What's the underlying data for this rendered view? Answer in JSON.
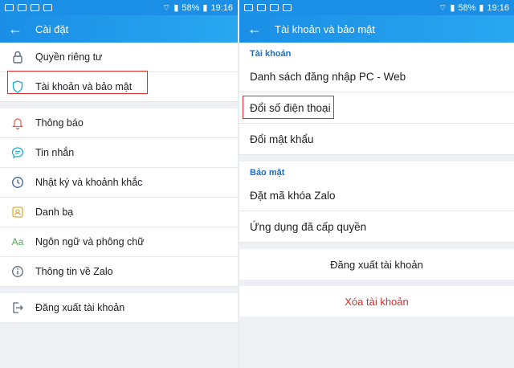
{
  "status": {
    "battery": "58%",
    "time": "19:16"
  },
  "left": {
    "title": "Cài đặt",
    "items_top": [
      {
        "icon": "lock-icon",
        "label": "Quyền riêng tư"
      },
      {
        "icon": "shield-icon",
        "label": "Tài khoản và bảo mật"
      }
    ],
    "items_mid": [
      {
        "icon": "bell-icon",
        "label": "Thông báo"
      },
      {
        "icon": "chat-icon",
        "label": "Tin nhắn"
      },
      {
        "icon": "clock-icon",
        "label": "Nhật ký và khoảnh khắc"
      },
      {
        "icon": "contacts-icon",
        "label": "Danh bạ"
      },
      {
        "icon": "font-icon",
        "label": "Ngôn ngữ và phông chữ",
        "icon_text": "Aa"
      },
      {
        "icon": "info-icon",
        "label": "Thông tin về Zalo"
      }
    ],
    "logout": {
      "icon": "logout-icon",
      "label": "Đăng xuất tài khoản"
    }
  },
  "right": {
    "title": "Tài khoản và bảo mật",
    "section_account": "Tài khoản",
    "account_items": [
      "Danh sách đăng nhập PC - Web",
      "Đổi số điện thoại",
      "Đổi mật khẩu"
    ],
    "section_security": "Bảo mật",
    "security_items": [
      "Đặt mã khóa Zalo",
      "Ứng dụng đã cấp quyền"
    ],
    "logout_label": "Đăng xuất tài khoản",
    "delete_label": "Xóa tài khoản"
  },
  "colors": {
    "appbar": "#1a8ee6",
    "accent": "#1d6fc4",
    "danger": "#d0302e",
    "highlight": "#d9312e"
  }
}
